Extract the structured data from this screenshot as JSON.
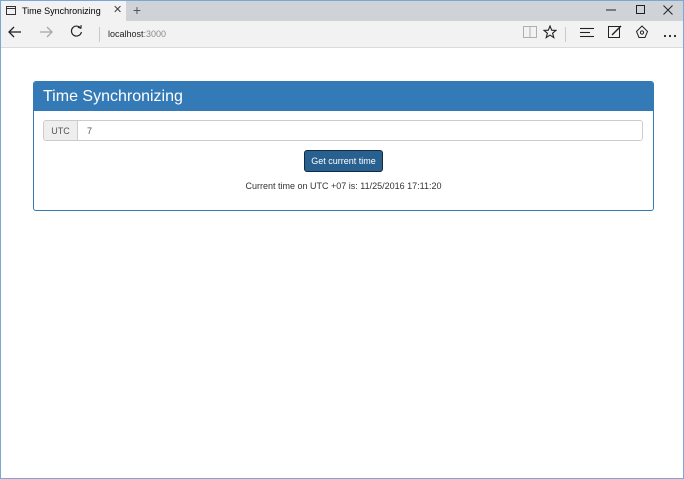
{
  "browser": {
    "tab_title": "Time Synchronizing",
    "tab_close": "✕",
    "new_tab": "+",
    "address_host": "localhost",
    "address_port": ":3000"
  },
  "page": {
    "panel_title": "Time Synchronizing",
    "utc_addon": "UTC",
    "utc_value": "7",
    "button_label": "Get current time",
    "result_text": "Current time on UTC +07 is: 11/25/2016 17:11:20"
  },
  "colors": {
    "panel_primary": "#337ab7",
    "button_bg": "#286090",
    "tab_bar": "#cfd3d7",
    "nav_bar": "#f2f2f2"
  },
  "icons": [
    "tab-favicon-icon",
    "back-arrow-icon",
    "forward-arrow-icon",
    "refresh-icon",
    "reading-view-icon",
    "favorite-star-icon",
    "hub-icon",
    "web-note-icon",
    "share-icon",
    "more-icon",
    "minimize-icon",
    "maximize-icon",
    "close-icon"
  ]
}
